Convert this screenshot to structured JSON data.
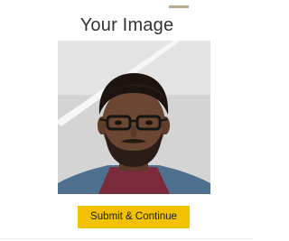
{
  "header": {
    "title": "Your Image"
  },
  "photo": {
    "icon": "user-photo"
  },
  "actions": {
    "submit_label": "Submit & Continue"
  },
  "colors": {
    "accent": "#f2c200",
    "title": "#333333",
    "background": "#ffffff"
  }
}
